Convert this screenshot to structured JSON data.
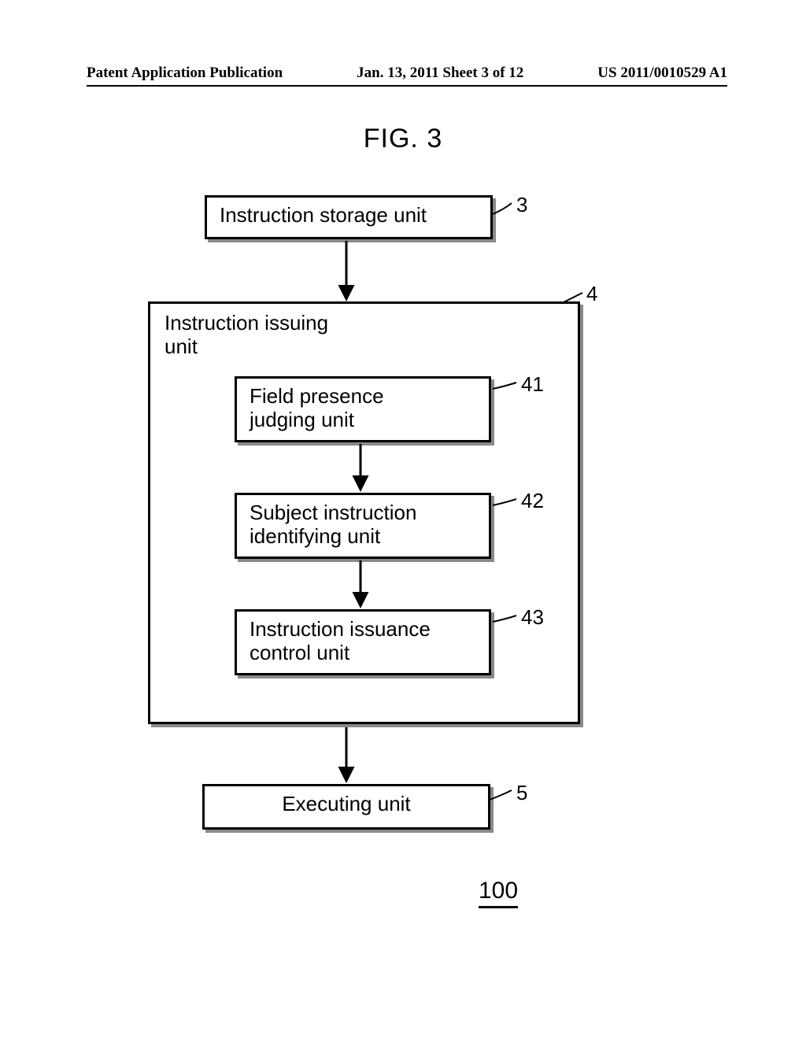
{
  "header": {
    "left": "Patent Application Publication",
    "center": "Jan. 13, 2011  Sheet 3 of 12",
    "right": "US 2011/0010529 A1"
  },
  "figure": {
    "title": "FIG. 3",
    "page_ref": "100"
  },
  "blocks": {
    "storage": {
      "label": "Instruction storage unit",
      "ref": "3"
    },
    "issuing": {
      "label": "Instruction issuing\nunit",
      "ref": "4"
    },
    "b41": {
      "label": "Field presence\njudging unit",
      "ref": "41"
    },
    "b42": {
      "label": "Subject instruction\nidentifying unit",
      "ref": "42"
    },
    "b43": {
      "label": "Instruction issuance\ncontrol unit",
      "ref": "43"
    },
    "exec": {
      "label": "Executing unit",
      "ref": "5"
    }
  }
}
